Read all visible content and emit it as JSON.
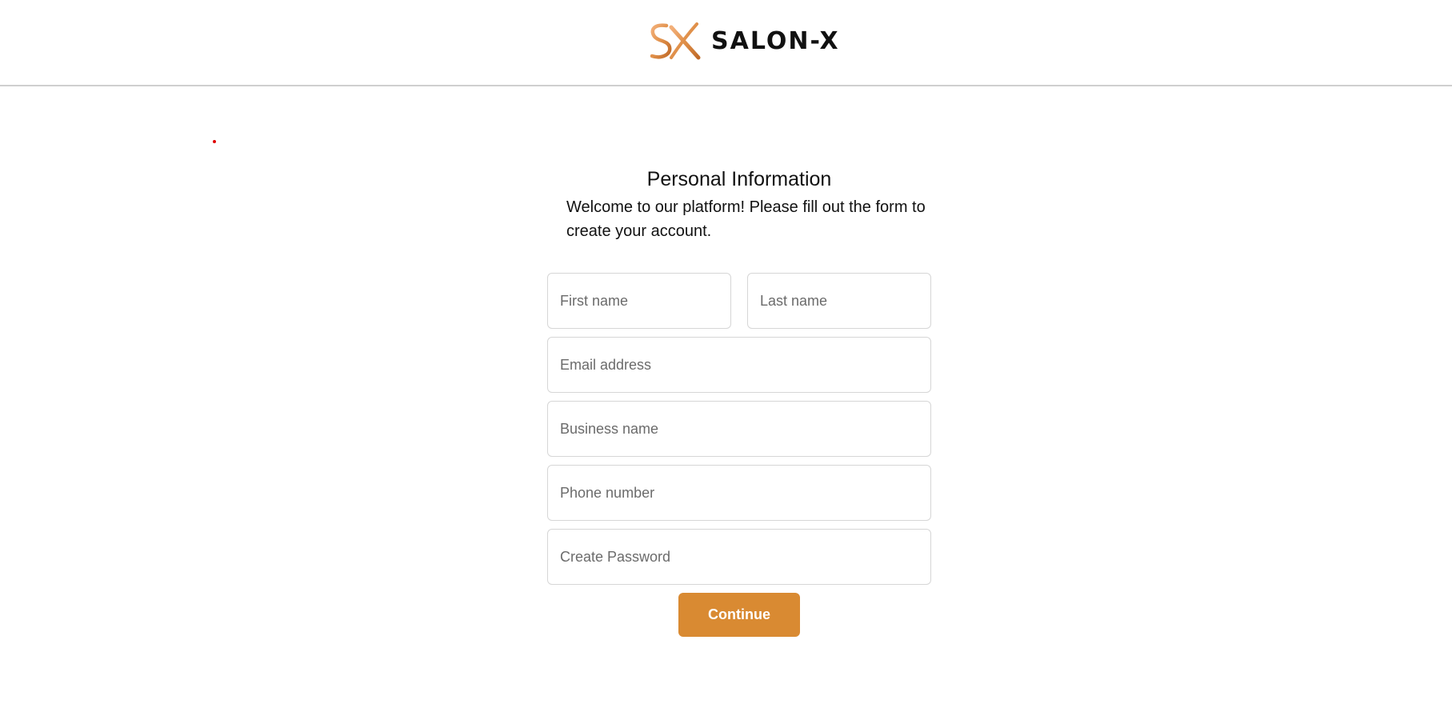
{
  "header": {
    "brand_name": "SALON-X",
    "logo_icon": "sx-monogram-logo"
  },
  "form": {
    "title": "Personal Information",
    "subtitle": "Welcome to our platform! Please fill out the form to create your account.",
    "fields": {
      "first_name": {
        "placeholder": "First name",
        "value": ""
      },
      "last_name": {
        "placeholder": "Last name",
        "value": ""
      },
      "email": {
        "placeholder": "Email address",
        "value": ""
      },
      "business_name": {
        "placeholder": "Business name",
        "value": ""
      },
      "phone": {
        "placeholder": "Phone number",
        "value": ""
      },
      "password": {
        "placeholder": "Create Password",
        "value": ""
      }
    },
    "continue_label": "Continue"
  },
  "colors": {
    "accent": "#d98a32",
    "logo_orange": "#e0904a",
    "marker_red": "#e00000",
    "divider": "#cfcfcf"
  }
}
